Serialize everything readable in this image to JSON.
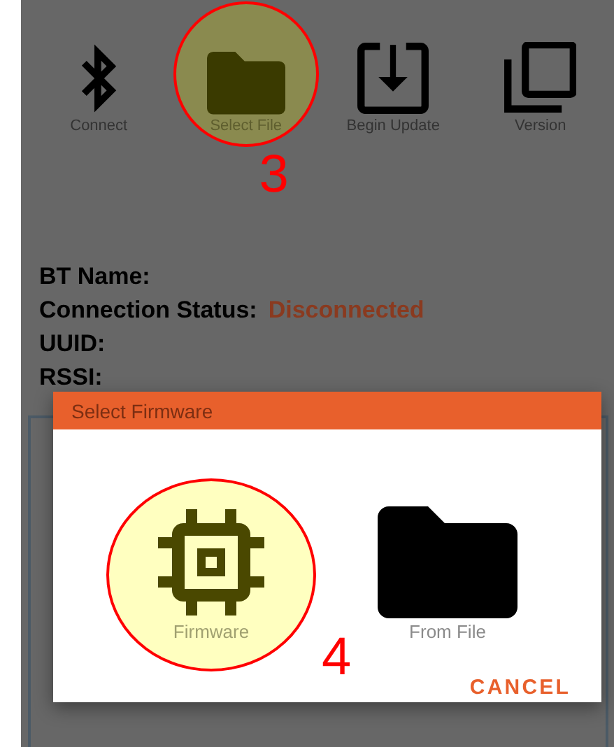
{
  "toolbar": [
    {
      "label": "Connect",
      "kind": "bluetooth",
      "highlighted": false
    },
    {
      "label": "Select File",
      "kind": "folder",
      "highlighted": true,
      "callout": "3"
    },
    {
      "label": "Begin Update",
      "kind": "download",
      "highlighted": false
    },
    {
      "label": "Version",
      "kind": "copy",
      "highlighted": false
    }
  ],
  "info": [
    {
      "label": "BT Name:"
    },
    {
      "label": "Connection Status:",
      "value": "Disconnected"
    },
    {
      "label": "UUID:"
    },
    {
      "label": "RSSI:"
    }
  ],
  "dialog": {
    "title": "Select Firmware",
    "options": [
      {
        "label": "Firmware",
        "kind": "chip",
        "highlighted": true,
        "callout": "4"
      },
      {
        "label": "From File",
        "kind": "folder",
        "highlighted": false
      }
    ],
    "button": "CANCEL"
  }
}
